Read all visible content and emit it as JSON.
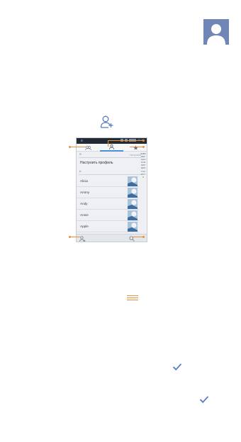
{
  "colors": {
    "accent_blue": "#5a7bc0",
    "callout_orange": "#e8913a",
    "avatar_bg": "#6f86b6"
  },
  "phone": {
    "status_time": "11:11",
    "section_me": "Я",
    "section_me_right": "Настроить",
    "profile_label": "Настроить профиль",
    "section_a": "A",
    "contacts": [
      {
        "name": "Alicia"
      },
      {
        "name": "Ammy"
      },
      {
        "name": "Andy"
      },
      {
        "name": "Annie"
      },
      {
        "name": "Apple"
      }
    ],
    "alphabet": "#ABCDEFGHIJKLMNOPQRSTUVWXYZ"
  },
  "icons": {
    "big_avatar": "person-avatar-icon",
    "add_contact": "add-contact-icon",
    "menu": "menu-icon",
    "check": "check-icon"
  }
}
